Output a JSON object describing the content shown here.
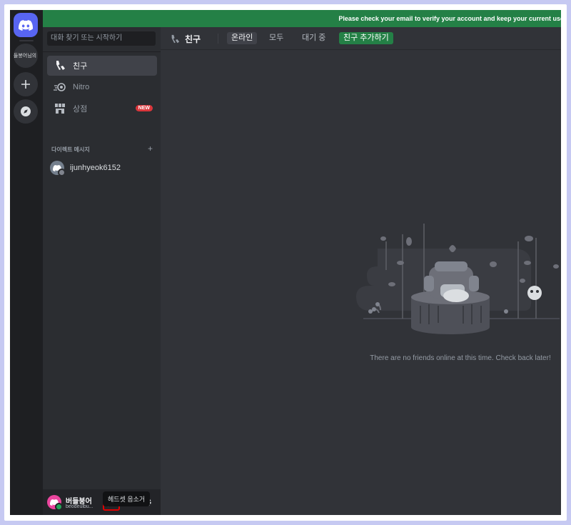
{
  "banner": {
    "text": "Please check your email to verify your account and keep your current use"
  },
  "servers": {
    "guild_label": "버들붕어님의 서"
  },
  "sidebar": {
    "search_placeholder": "대화 찾기 또는 시작하기",
    "nav": [
      {
        "label": "친구"
      },
      {
        "label": "Nitro"
      },
      {
        "label": "상점",
        "badge": "NEW"
      }
    ],
    "dm_header": "다이렉트 메시지",
    "dm_add": "+",
    "dms": [
      {
        "name": "ijunhyeok6152"
      }
    ]
  },
  "user": {
    "name": "버들붕어",
    "tag": "beodeulbu...",
    "tooltip": "헤드셋 음소거"
  },
  "topbar": {
    "title": "친구",
    "tabs": [
      "온라인",
      "모두",
      "대기 중"
    ],
    "add_friend": "친구 추가하기"
  },
  "main": {
    "empty_text": "There are no friends online at this time. Check back later!"
  },
  "colors": {
    "blurple": "#5865f2",
    "green": "#248046",
    "red_badge": "#da373c",
    "bg": "#313338"
  }
}
